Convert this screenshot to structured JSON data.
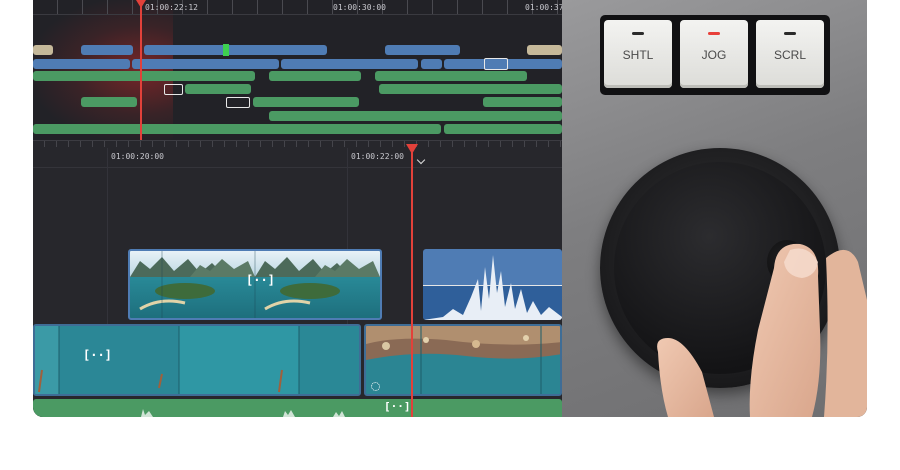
{
  "timeline": {
    "overview_timecodes": [
      "01:00:22:12",
      "01:00:30:00",
      "01:00:37:1"
    ],
    "detail_timecodes": [
      "01:00:20:00",
      "01:00:22:00"
    ]
  },
  "panel": {
    "keys": [
      {
        "label": "SHTL",
        "led_color": "#2b2b2b"
      },
      {
        "label": "JOG",
        "led_color": "#e8403a"
      },
      {
        "label": "SCRL",
        "led_color": "#2b2b2b"
      }
    ],
    "knob_label": "search dial"
  },
  "colors": {
    "playhead": "#e2413a",
    "video_clip": "#4f7cb4",
    "audio_clip": "#4b9a63",
    "editor_bg": "#26262b"
  }
}
